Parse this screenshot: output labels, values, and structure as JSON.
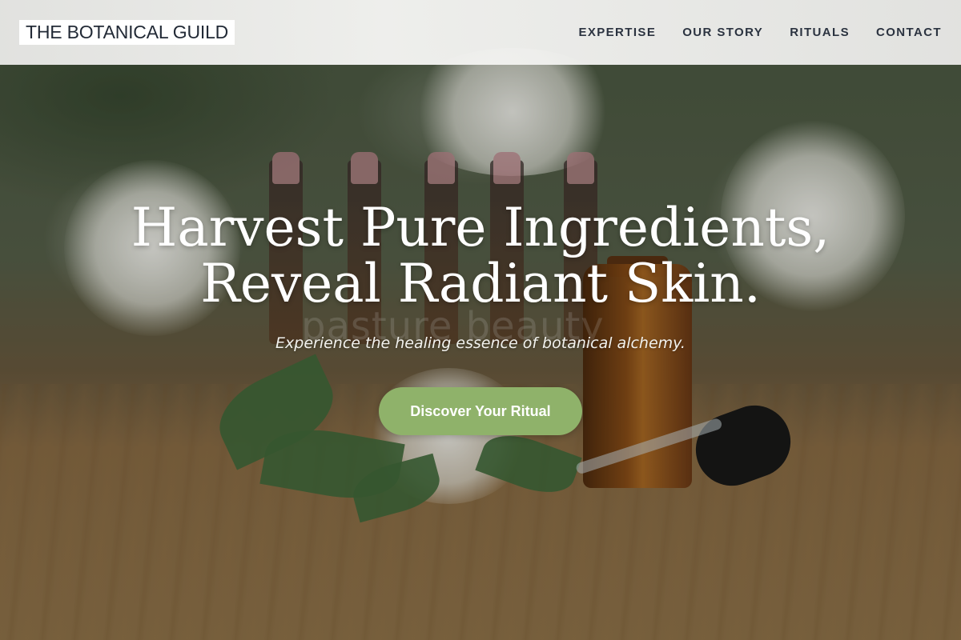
{
  "header": {
    "logo_text": "THE BOTANICAL GUILD",
    "nav": [
      {
        "label": "EXPERTISE"
      },
      {
        "label": "OUR STORY"
      },
      {
        "label": "RITUALS"
      },
      {
        "label": "CONTACT"
      }
    ]
  },
  "hero": {
    "headline_line1": "Harvest Pure Ingredients,",
    "headline_line2": "Reveal Radiant Skin.",
    "subtitle": "Experience the healing essence of botanical alchemy.",
    "cta_label": "Discover Your Ritual",
    "background_image_watermark": "pasture beauty"
  },
  "colors": {
    "cta_background": "#8fb26a",
    "header_text": "#2b3340",
    "headline_text": "#ffffff"
  }
}
